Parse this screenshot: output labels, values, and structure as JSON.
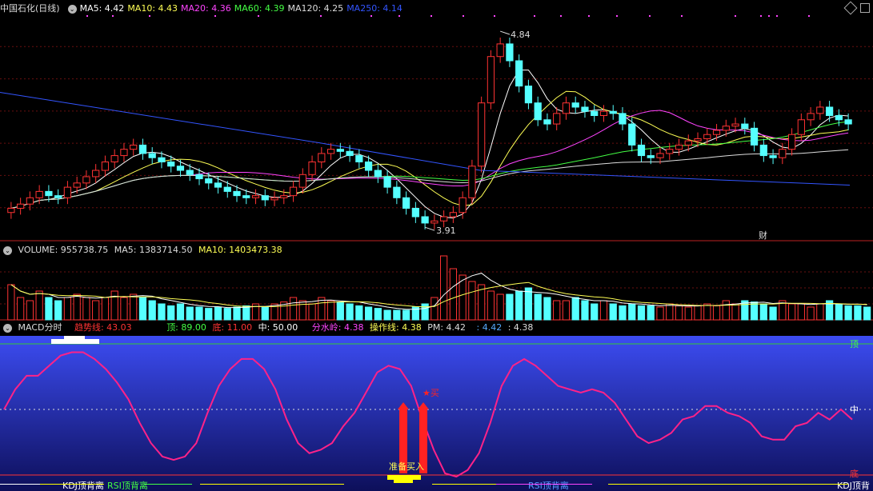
{
  "price_header": {
    "title": "中国石化(日线)",
    "items": [
      {
        "label": "MA5: 4.42",
        "color": "#ffffff"
      },
      {
        "label": "MA10: 4.43",
        "color": "#ffff55"
      },
      {
        "label": "MA20: 4.36",
        "color": "#ff44ff"
      },
      {
        "label": "MA60: 4.39",
        "color": "#44ff44"
      },
      {
        "label": "MA120: 4.25",
        "color": "#dddddd"
      },
      {
        "label": "MA250: 4.14",
        "color": "#3355ff"
      }
    ]
  },
  "price_panel": {
    "high_label": "4.84",
    "low_label": "3.91",
    "finance_marker": "财",
    "y_range": [
      3.85,
      4.92
    ]
  },
  "volume_header": {
    "title": "VOLUME: 955738.75",
    "ma5": "MA5: 1383714.50",
    "ma10": "MA10: 1403473.38"
  },
  "indicator_header": {
    "title": "MACD分时",
    "trend": "趋势线: 43.03",
    "top": "顶: 89.00",
    "bottom": "底: 11.00",
    "mid": "中: 50.00",
    "watershed": "分水岭: 4.38",
    "operation": "操作线: 4.38",
    "pm": "PM: 4.42",
    "v1": ": 4.42",
    "v2": ": 4.38"
  },
  "indicator_panel": {
    "top_tag": "顶",
    "mid_tag": "中",
    "bottom_tag": "底",
    "buy_signal": "★买",
    "prepare_buy": "准备买入",
    "kdj_divergence_left": "KDJ顶背离",
    "rsi_divergence_left": "RSI顶背离",
    "rsi_divergence_mid": "RSI顶背离",
    "kdj_divergence_right": "KDJ顶背",
    "trend_values": [
      50,
      62,
      70,
      70,
      76,
      82,
      84,
      84,
      80,
      74,
      66,
      56,
      42,
      30,
      22,
      20,
      22,
      30,
      48,
      64,
      74,
      80,
      80,
      74,
      62,
      44,
      30,
      24,
      26,
      30,
      40,
      48,
      60,
      72,
      76,
      74,
      64,
      44,
      26,
      12,
      10,
      14,
      24,
      42,
      64,
      76,
      80,
      76,
      70,
      64,
      62,
      60,
      62,
      60,
      54,
      44,
      34,
      30,
      32,
      36,
      44,
      46,
      52,
      52,
      48,
      46,
      42,
      34,
      32,
      32,
      40,
      42,
      48,
      44,
      50,
      44
    ]
  },
  "chart_data": [
    {
      "type": "candlestick",
      "title": "中国石化(日线)",
      "series": [
        {
          "name": "K线",
          "ohlc_close": [
            4.0,
            4.02,
            4.05,
            4.08,
            4.06,
            4.05,
            4.1,
            4.12,
            4.15,
            4.18,
            4.22,
            4.25,
            4.28,
            4.3,
            4.26,
            4.24,
            4.22,
            4.2,
            4.18,
            4.16,
            4.14,
            4.12,
            4.1,
            4.08,
            4.06,
            4.05,
            4.06,
            4.04,
            4.05,
            4.06,
            4.1,
            4.16,
            4.22,
            4.26,
            4.28,
            4.27,
            4.25,
            4.22,
            4.18,
            4.15,
            4.1,
            4.05,
            4.0,
            3.96,
            3.93,
            3.94,
            3.96,
            3.98,
            4.05,
            4.2,
            4.5,
            4.72,
            4.78,
            4.7,
            4.58,
            4.5,
            4.42,
            4.4,
            4.45,
            4.5,
            4.48,
            4.46,
            4.44,
            4.46,
            4.45,
            4.4,
            4.3,
            4.25,
            4.24,
            4.26,
            4.28,
            4.3,
            4.32,
            4.33,
            4.35,
            4.37,
            4.39,
            4.4,
            4.38,
            4.3,
            4.25,
            4.24,
            4.28,
            4.35,
            4.42,
            4.45,
            4.48,
            4.44,
            4.42,
            4.4
          ]
        },
        {
          "name": "MA5",
          "close": 4.42
        },
        {
          "name": "MA10",
          "close": 4.43
        },
        {
          "name": "MA20",
          "close": 4.36
        },
        {
          "name": "MA60",
          "close": 4.39
        },
        {
          "name": "MA120",
          "close": 4.25
        },
        {
          "name": "MA250",
          "close": 4.14
        }
      ],
      "annotations": [
        "4.84",
        "3.91"
      ]
    },
    {
      "type": "bar",
      "title": "VOLUME",
      "values": [
        55,
        35,
        30,
        45,
        35,
        30,
        35,
        40,
        35,
        30,
        35,
        45,
        35,
        40,
        35,
        30,
        25,
        22,
        25,
        20,
        20,
        18,
        20,
        18,
        20,
        22,
        25,
        20,
        25,
        28,
        35,
        30,
        25,
        35,
        30,
        28,
        25,
        22,
        20,
        18,
        15,
        15,
        15,
        20,
        25,
        35,
        100,
        80,
        70,
        60,
        55,
        45,
        40,
        40,
        45,
        50,
        40,
        35,
        30,
        30,
        35,
        30,
        25,
        30,
        25,
        22,
        25,
        22,
        22,
        20,
        25,
        22,
        20,
        22,
        25,
        22,
        30,
        25,
        30,
        28,
        25,
        20,
        30,
        25,
        25,
        20,
        25,
        30,
        25,
        22,
        22,
        20
      ],
      "series": [
        {
          "name": "MA5",
          "value": "1383714.50"
        },
        {
          "name": "MA10",
          "value": "1403473.38"
        }
      ]
    },
    {
      "type": "line",
      "title": "MACD分时",
      "series": [
        {
          "name": "趋势线",
          "last": 43.03
        }
      ],
      "reference_lines": {
        "顶": 89.0,
        "中": 50.0,
        "底": 11.0
      }
    }
  ]
}
